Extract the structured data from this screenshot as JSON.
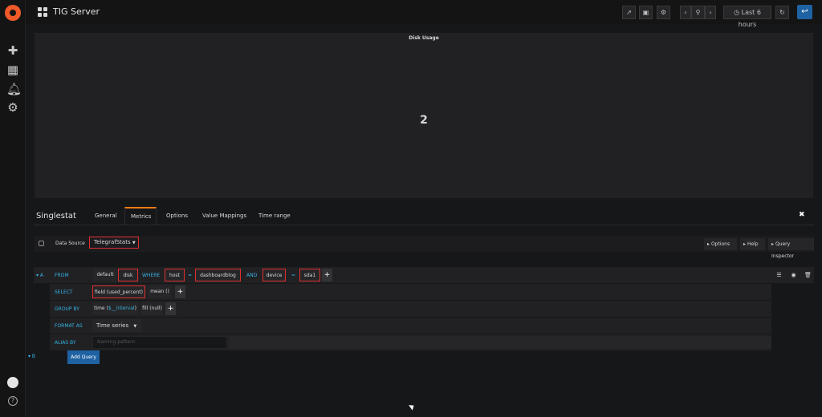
{
  "topbar": {
    "title": "TIG Server",
    "time_range": "Last 6 hours"
  },
  "panel": {
    "title": "Disk Usage",
    "value": "2"
  },
  "editor": {
    "title": "Singlestat",
    "tabs": [
      "General",
      "Metrics",
      "Options",
      "Value Mappings",
      "Time range"
    ],
    "active_tab": "Metrics",
    "datasource": {
      "label": "Data Source",
      "value": "TelegrafStats",
      "buttons": [
        "Options",
        "Help",
        "Query Inspector"
      ]
    }
  },
  "query": {
    "ref_a": "A",
    "ref_b": "B",
    "from": {
      "label": "FROM",
      "policy": "default",
      "measurement": "disk",
      "where_label": "WHERE",
      "and_label": "AND",
      "tag1": "host",
      "op1": "=",
      "val1": "dashboardblog",
      "tag2": "device",
      "op2": "=",
      "val2": "sda1"
    },
    "select": {
      "label": "SELECT",
      "field": "field (used_percent)",
      "fn": "mean ()"
    },
    "group_by": {
      "label": "GROUP BY",
      "time_prefix": "time (",
      "time_var": "$__interval",
      "time_suffix": ")",
      "fill": "fill (null)"
    },
    "format_as": {
      "label": "FORMAT AS",
      "value": "Time series"
    },
    "alias_by": {
      "label": "ALIAS BY",
      "placeholder": "Naming pattern"
    },
    "add_query": "Add Query"
  },
  "colors": {
    "accent": "#eb7b18",
    "keyword": "#33b5e5",
    "highlight": "#e02f2f",
    "primary_button": "#1f62a3"
  }
}
